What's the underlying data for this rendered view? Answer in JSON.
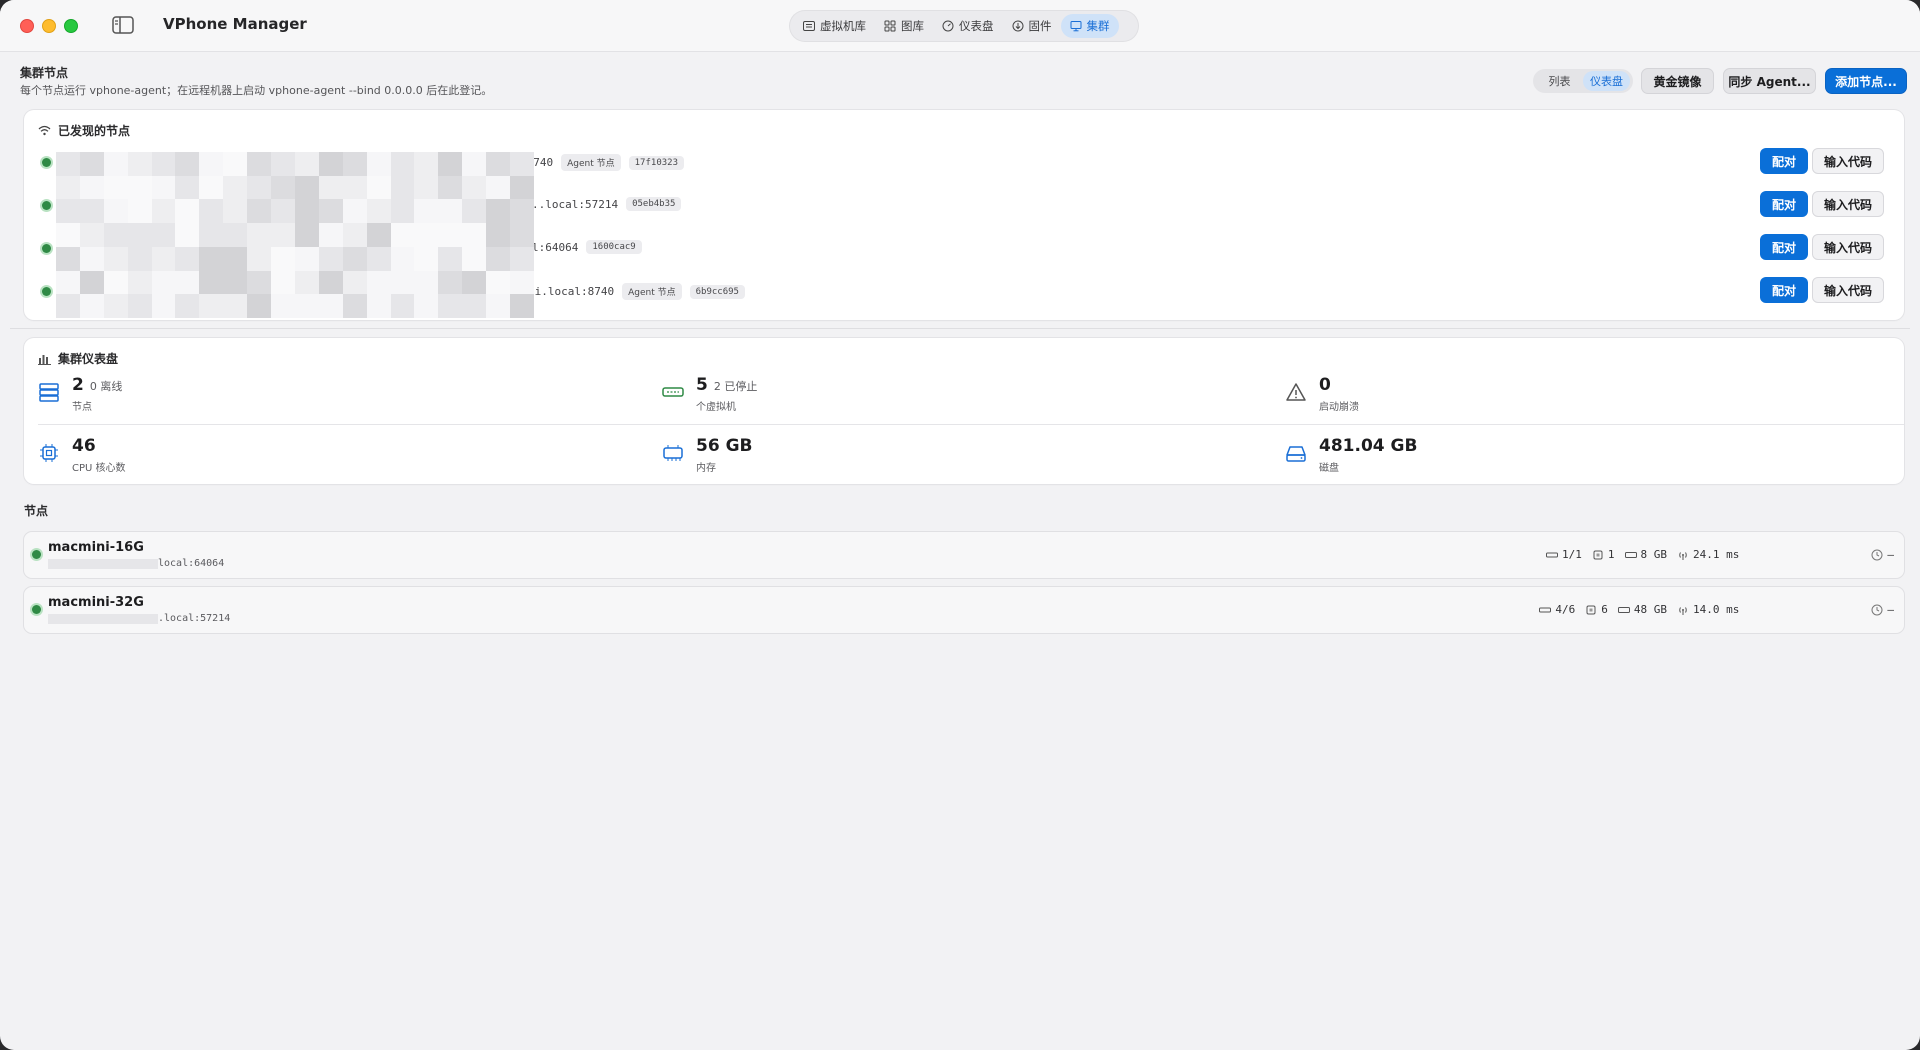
{
  "app": {
    "title": "VPhone Manager"
  },
  "nav": {
    "tabs": [
      {
        "label": "虚拟机库",
        "icon": "list-icon"
      },
      {
        "label": "图库",
        "icon": "grid-icon"
      },
      {
        "label": "仪表盘",
        "icon": "gauge-icon"
      },
      {
        "label": "固件",
        "icon": "download-icon"
      },
      {
        "label": "集群",
        "icon": "display-icon",
        "active": true
      }
    ]
  },
  "header": {
    "title": "集群节点",
    "description": "每个节点运行 vphone-agent；在远程机器上启动 vphone-agent --bind 0.0.0.0 后在此登记。",
    "view_toggle": {
      "list": "列表",
      "dashboard": "仪表盘",
      "active": "dashboard"
    },
    "buttons": {
      "golden_image": "黄金镜像",
      "sync_agent": "同步 Agent...",
      "add_node": "添加节点..."
    }
  },
  "discovered": {
    "title": "已发现的节点",
    "pair_label": "配对",
    "code_label": "输入代码",
    "nodes": [
      {
        "address": ":8740",
        "tags": [
          "Agent 节点",
          "17f10323"
        ]
      },
      {
        "address": "..local:57214",
        "tags": [
          "05eb4b35"
        ]
      },
      {
        "address": "l:64064",
        "tags": [
          "1600cac9"
        ]
      },
      {
        "address": "ni.local:8740",
        "tags": [
          "Agent 节点",
          "6b9cc695"
        ]
      }
    ]
  },
  "dashboard": {
    "title": "集群仪表盘",
    "stats": {
      "nodes": {
        "value": "2",
        "sub": "0 离线",
        "label": "节点"
      },
      "vms": {
        "value": "5",
        "sub": "2 已停止",
        "label": "个虚拟机"
      },
      "crashes": {
        "value": "0",
        "sub": "",
        "label": "启动崩溃"
      },
      "cpu": {
        "value": "46",
        "sub": "",
        "label": "CPU 核心数"
      },
      "memory": {
        "value": "56 GB",
        "sub": "",
        "label": "内存"
      },
      "disk": {
        "value": "481.04 GB",
        "sub": "",
        "label": "磁盘"
      }
    },
    "colors": {
      "accent": "#0a6fd8",
      "online": "#2f8a45",
      "vm_icon": "#2f8a45"
    }
  },
  "nodes": {
    "title": "节点",
    "items": [
      {
        "name": "macmini-16G",
        "address": "local:64064",
        "vms": "1/1",
        "cpu": "1",
        "memory": "8 GB",
        "latency": "24.1 ms",
        "extra": "—"
      },
      {
        "name": "macmini-32G",
        "address": ".local:57214",
        "vms": "4/6",
        "cpu": "6",
        "memory": "48 GB",
        "latency": "14.0 ms",
        "extra": "—"
      }
    ]
  }
}
